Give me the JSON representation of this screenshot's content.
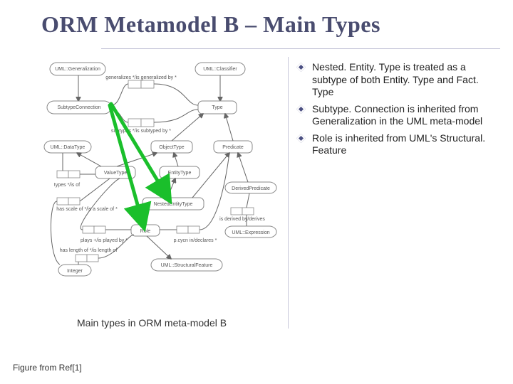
{
  "title": "ORM Metamodel B – Main Types",
  "caption": "Main types in ORM meta-model B",
  "footnote": "Figure from Ref[1]",
  "bullets": [
    "Nested. Entity. Type is treated as a subtype of both Entity. Type and Fact. Type",
    "Subtype. Connection is inherited from Generalization in the UML meta-model",
    "Role is inherited from UML's Structural. Feature"
  ],
  "diagram": {
    "nodes": [
      {
        "id": "umlgen",
        "label": "UML::Generalization"
      },
      {
        "id": "umlclass",
        "label": "UML::Classifier"
      },
      {
        "id": "subconn",
        "label": "SubtypeConnection"
      },
      {
        "id": "type",
        "label": "Type"
      },
      {
        "id": "umldt",
        "label": "UML::DataType"
      },
      {
        "id": "objtype",
        "label": "ObjectType"
      },
      {
        "id": "predicate",
        "label": "Predicate"
      },
      {
        "id": "valtype",
        "label": "ValueType"
      },
      {
        "id": "enttype",
        "label": "EntityType"
      },
      {
        "id": "nestent",
        "label": "NestedEntityType"
      },
      {
        "id": "derpred",
        "label": "DerivedPredicate"
      },
      {
        "id": "role",
        "label": "Role"
      },
      {
        "id": "umlsf",
        "label": "UML::StructuralFeature"
      },
      {
        "id": "umlexpr",
        "label": "UML::Expression"
      },
      {
        "id": "integer",
        "label": "Integer"
      }
    ],
    "edge_labels": [
      "generalizes */is generalized by *",
      "subtypes */is subtyped by *",
      "types */is of",
      "has scale of */is a scale of *",
      "plays +/is played by *",
      "has length of */is length of",
      "p.cycn in/declares *",
      "is derived by/derives"
    ]
  }
}
